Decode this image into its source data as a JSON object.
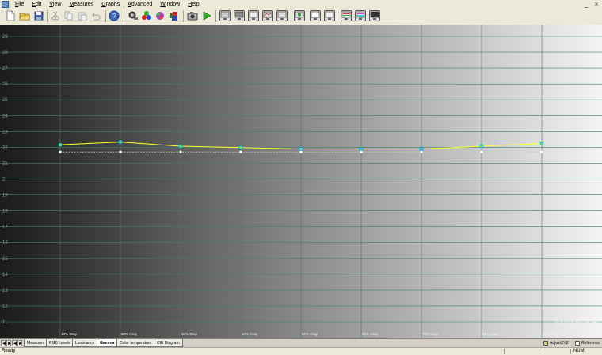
{
  "menu": [
    {
      "key": "F",
      "rest": "ile"
    },
    {
      "key": "E",
      "rest": "dit"
    },
    {
      "key": "V",
      "rest": "iew"
    },
    {
      "key": "M",
      "rest": "easures"
    },
    {
      "key": "G",
      "rest": "raphs"
    },
    {
      "key": "A",
      "rest": "dvanced"
    },
    {
      "key": "W",
      "rest": "indow"
    },
    {
      "key": "H",
      "rest": "elp"
    }
  ],
  "window_controls": {
    "minimize": "_",
    "close": "×"
  },
  "chart_data": {
    "type": "line",
    "y_tick_labels": [
      "29",
      "28",
      "27",
      "26",
      "25",
      "24",
      "23",
      "22",
      "21",
      "2",
      "19",
      "18",
      "17",
      "16",
      "15",
      "14",
      "13",
      "12",
      "11"
    ],
    "x_tick_labels": [
      "10% Gray",
      "20% Gray",
      "30% Gray",
      "40% Gray",
      "50% Gray",
      "60% Gray",
      "70% Gray",
      "80% Gray",
      "90% Gray"
    ],
    "series": [
      {
        "color": "#ffff40",
        "values": [
          2.24,
          2.26,
          2.23,
          2.22,
          2.21,
          2.21,
          2.21,
          2.23,
          2.25
        ]
      },
      {
        "color": "#c8c8c8",
        "values": [
          2.19,
          2.19,
          2.19,
          2.19,
          2.19,
          2.19,
          2.19,
          2.19,
          2.19
        ]
      }
    ],
    "ylim": [
      1.0,
      3.0
    ],
    "grid": true,
    "watermark": "hcfr.sourceforge.net"
  },
  "tabs": [
    {
      "label": "Measures",
      "active": false
    },
    {
      "label": "RGB Levels",
      "active": false
    },
    {
      "label": "Luminance",
      "active": false
    },
    {
      "label": "Gamma",
      "active": true
    },
    {
      "label": "Color temperature",
      "active": false
    },
    {
      "label": "CIE Diagram",
      "active": false
    }
  ],
  "nav_buttons": [
    "◄",
    "►",
    "◄",
    "►"
  ],
  "legend": [
    {
      "label": "AdjustXYZ",
      "checked": true
    },
    {
      "label": "Reference",
      "checked": false
    }
  ],
  "status": {
    "text": "Ready",
    "num": "NUM"
  }
}
